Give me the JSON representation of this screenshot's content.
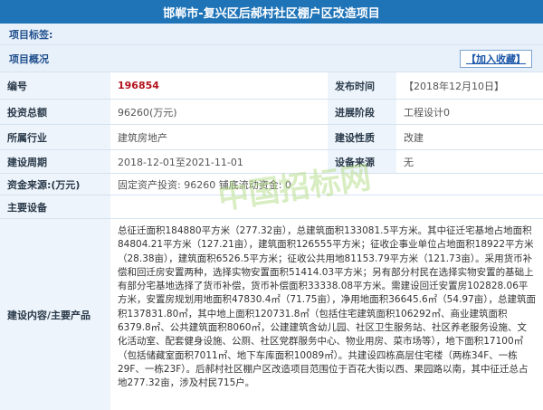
{
  "title": "邯郸市-复兴区后郝村社区棚户区改造项目",
  "tag_label": "项目标签:",
  "overview_label": "项目概况",
  "favorite_button": "【加入收藏】",
  "rows": {
    "r1": {
      "l1": "编号",
      "v1": "196854",
      "l2": "发布时间",
      "v2": "【2018年12月10日】"
    },
    "r2": {
      "l1": "投资总额",
      "v1": "96260(万元)",
      "l2": "进展阶段",
      "v2": "工程设计0"
    },
    "r3": {
      "l1": "所属行业",
      "v1": "建筑房地产",
      "l2": "建设性质",
      "v2": "改建"
    },
    "r4": {
      "l1": "建设周期",
      "v1": "2018-12-01至2021-11-01",
      "l2": "设备来源",
      "v2": "无"
    }
  },
  "funding": {
    "label": "资金来源:(万元)",
    "value": "固定资产投资: 96260   铺底流动资金: 0"
  },
  "equipment": {
    "label": "主要设备",
    "value": ""
  },
  "content": {
    "label": "建设内容/主要产品",
    "text": "总征迁面积184880平方米（277.32亩），总建筑面积133081.5平方米。其中征迁宅基地占地面积84804.21平方米（127.21亩），建筑面积126555平方米；征收企事业单位占地面积18922平方米（28.38亩），建筑面积6526.5平方米；征收公共用地81153.79平方米（121.73亩）。采用货币补偿和回迁房安置两种，选择实物安置面积51414.03平方米；另有部分村民在选择实物安置的基础上有部分宅基地选择了货币补偿，货币补偿面积33338.08平方米。需建设回迁安置房102828.06平方米，安置房规划用地面积47830.4㎡（71.75亩），净用地面积36645.6㎡（54.97亩），总建筑面积137831.80㎡，其中地上面积120731.8㎡（包括住宅建筑面积106292㎡、商业建筑面积6379.8㎡、公共建筑面积8060㎡，公建建筑含幼儿园、社区卫生服务站、社区养老服务设施、文化活动室、配套健身设施、公厕、社区党群服务中心、物业用房、菜市场等），地下面积17100㎡（包括储藏室面积7011㎡、地下车库面积10089㎡）。共建设四栋高层住宅楼（两栋34F、一栋29F、一栋23F）。后郝村社区棚户区改造项目范围位于百花大街以西、果园路以南，其中征迁总占地277.32亩，涉及村民715户。"
  },
  "watermark_text": "中国招标网"
}
